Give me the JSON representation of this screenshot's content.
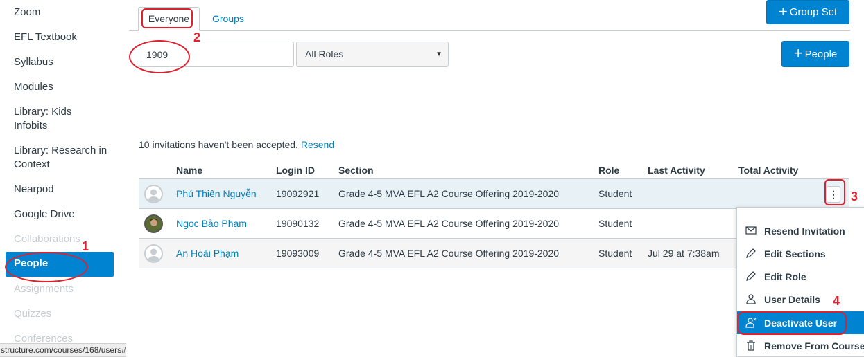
{
  "sidebar": {
    "items": [
      {
        "label": "Zoom"
      },
      {
        "label": "EFL Textbook"
      },
      {
        "label": "Syllabus"
      },
      {
        "label": "Modules"
      },
      {
        "label": "Library: Kids Infobits"
      },
      {
        "label": "Library: Research in Context"
      },
      {
        "label": "Nearpod"
      },
      {
        "label": "Google Drive"
      },
      {
        "label": "Collaborations"
      },
      {
        "label": "People"
      },
      {
        "label": "Assignments"
      },
      {
        "label": "Quizzes"
      },
      {
        "label": "Conferences"
      }
    ]
  },
  "status_url": "structure.com/courses/168/users#",
  "tabs": {
    "everyone": "Everyone",
    "groups": "Groups"
  },
  "buttons": {
    "group_set": "Group Set",
    "people": "People"
  },
  "search": {
    "value": "1909"
  },
  "role_filter": {
    "selected": "All Roles"
  },
  "invitations": {
    "text": "10 invitations haven't been accepted.",
    "resend": "Resend"
  },
  "table": {
    "headers": {
      "name": "Name",
      "login": "Login ID",
      "section": "Section",
      "role": "Role",
      "last": "Last Activity",
      "total": "Total Activity"
    },
    "rows": [
      {
        "name": "Phú Thiên Nguyễn",
        "login": "19092921",
        "section": "Grade 4-5 MVA EFL A2 Course Offering 2019-2020",
        "role": "Student",
        "last": "",
        "total": ""
      },
      {
        "name": "Ngọc Bảo Phạm",
        "login": "19090132",
        "section": "Grade 4-5 MVA EFL A2 Course Offering 2019-2020",
        "role": "Student",
        "last": "",
        "total": ""
      },
      {
        "name": "An Hoài Phạm",
        "login": "19093009",
        "section": "Grade 4-5 MVA EFL A2 Course Offering 2019-2020",
        "role": "Student",
        "last": "Jul 29 at 7:38am",
        "total": ""
      }
    ]
  },
  "menu": {
    "items": [
      {
        "label": "Resend Invitation",
        "icon": "envelope-icon"
      },
      {
        "label": "Edit Sections",
        "icon": "pencil-icon"
      },
      {
        "label": "Edit Role",
        "icon": "pencil-icon"
      },
      {
        "label": "User Details",
        "icon": "user-icon"
      },
      {
        "label": "Deactivate User",
        "icon": "user-x-icon"
      },
      {
        "label": "Remove From Course",
        "icon": "trash-icon"
      }
    ]
  },
  "annotations": [
    "1",
    "2",
    "3",
    "4"
  ],
  "colors": {
    "accent": "#0084d1",
    "link": "#0081bd",
    "annotation": "#e0202e",
    "highlight_row": "#e8f1f6"
  }
}
